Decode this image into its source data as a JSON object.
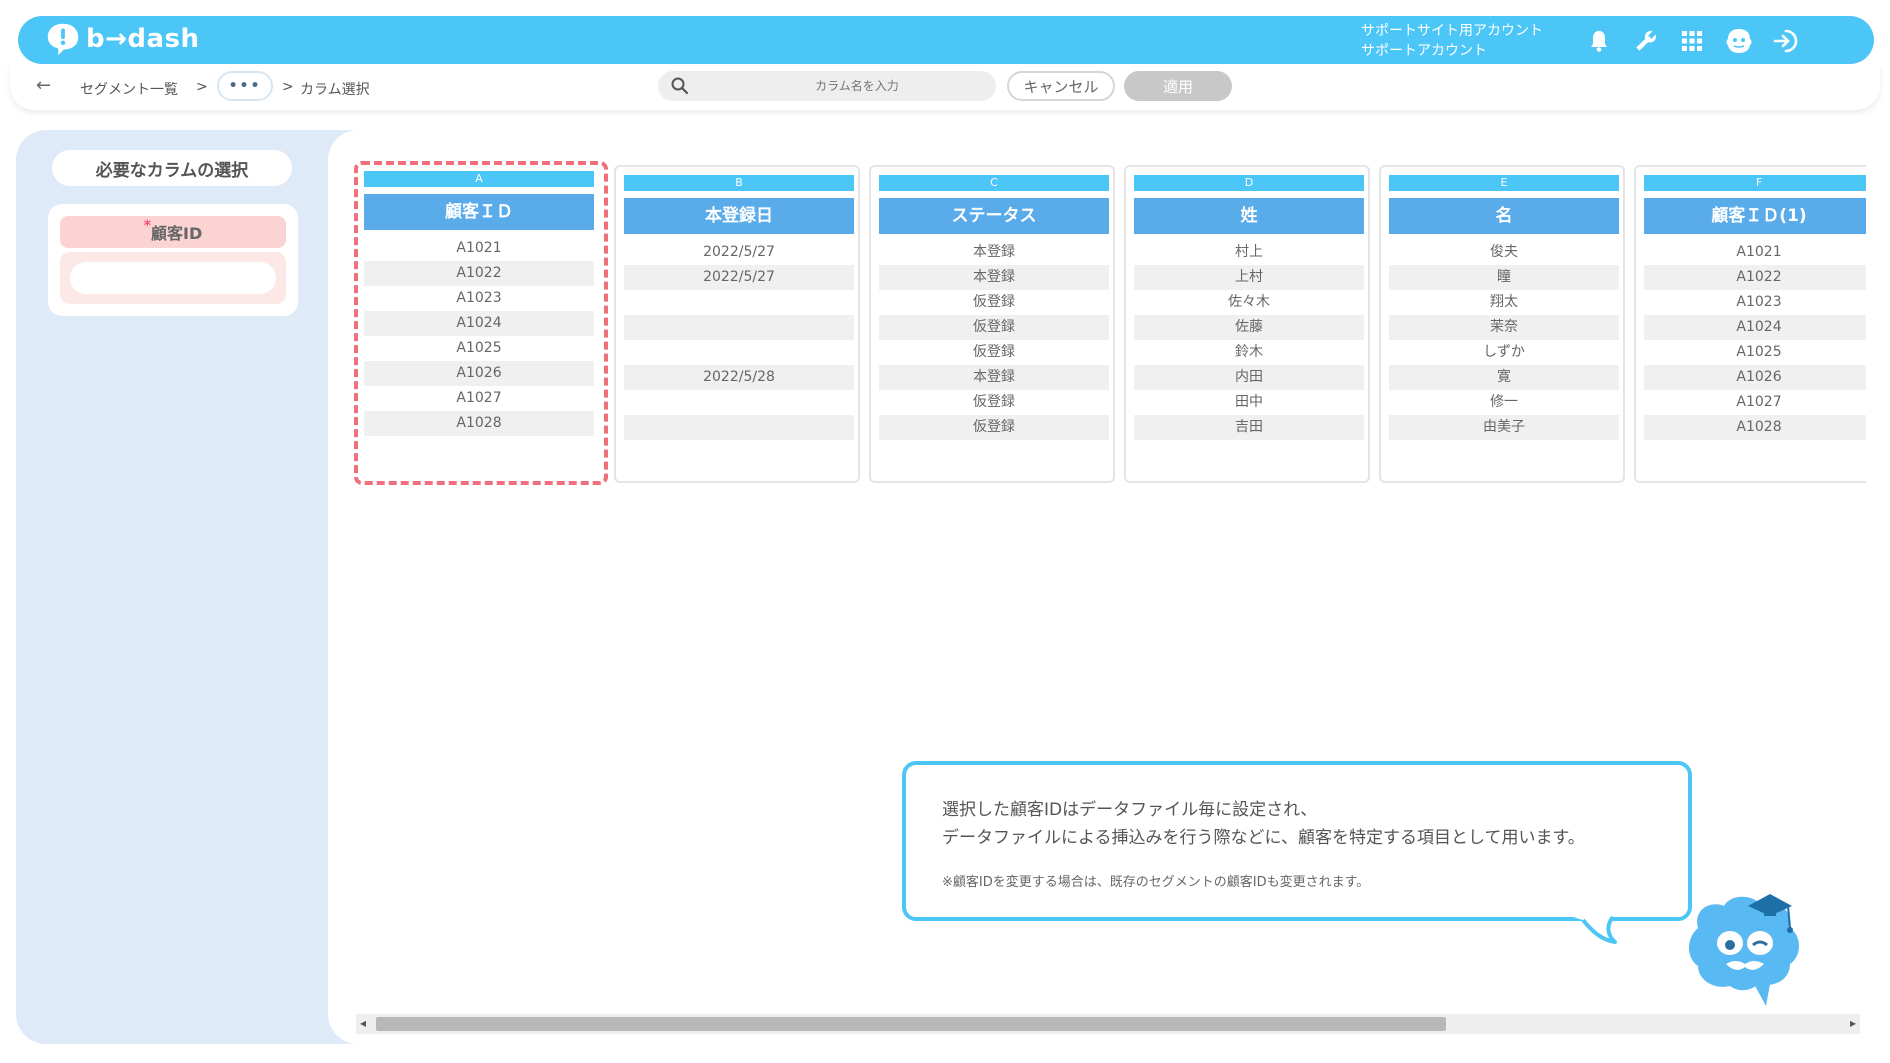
{
  "header": {
    "logo_text": "b→dash",
    "account_line1": "サポートサイト用アカウント",
    "account_line2": "サポートアカウント",
    "icons": [
      "bell-icon",
      "wrench-icon",
      "grid-icon",
      "mascot-icon",
      "logout-icon"
    ]
  },
  "toolbar": {
    "back": "←",
    "breadcrumb_segments": "セグメント一覧",
    "sep1": ">",
    "dots": "•••",
    "sep2": ">",
    "breadcrumb_current": "カラム選択",
    "search_placeholder": "カラム名を入力",
    "cancel_label": "キャンセル",
    "apply_label": "適用"
  },
  "sidebar": {
    "title": "必要なカラムの選択",
    "required_star": "*",
    "required_label": "顧客ID"
  },
  "columns": [
    {
      "letter": "A",
      "name": "顧客ＩＤ",
      "cells": [
        "A1021",
        "A1022",
        "A1023",
        "A1024",
        "A1025",
        "A1026",
        "A1027",
        "A1028"
      ]
    },
    {
      "letter": "B",
      "name": "本登録日",
      "cells": [
        "2022/5/27",
        "2022/5/27",
        "",
        "",
        "",
        "2022/5/28",
        "",
        ""
      ]
    },
    {
      "letter": "C",
      "name": "ステータス",
      "cells": [
        "本登録",
        "本登録",
        "仮登録",
        "仮登録",
        "仮登録",
        "本登録",
        "仮登録",
        "仮登録"
      ]
    },
    {
      "letter": "D",
      "name": "姓",
      "cells": [
        "村上",
        "上村",
        "佐々木",
        "佐藤",
        "鈴木",
        "内田",
        "田中",
        "吉田"
      ]
    },
    {
      "letter": "E",
      "name": "名",
      "cells": [
        "俊夫",
        "瞳",
        "翔太",
        "茉奈",
        "しずか",
        "寛",
        "修一",
        "由美子"
      ]
    },
    {
      "letter": "F",
      "name": "顧客ＩＤ(1)",
      "cells": [
        "A1021",
        "A1022",
        "A1023",
        "A1024",
        "A1025",
        "A1026",
        "A1027",
        "A1028"
      ]
    }
  ],
  "tooltip": {
    "line1": "選択した顧客IDはデータファイル毎に設定され、",
    "line2": "データファイルによる挿込みを行う際などに、顧客を特定する項目として用います。",
    "note": "※顧客IDを変更する場合は、既存のセグメントの顧客IDも変更されます。"
  },
  "scrollbar": {
    "left_arrow": "◂",
    "right_arrow": "▸"
  },
  "colors": {
    "brand": "#4cc6f7",
    "column_header": "#5aabea",
    "selected_border": "#f06f7a",
    "panel_bg": "#deeaf7"
  }
}
